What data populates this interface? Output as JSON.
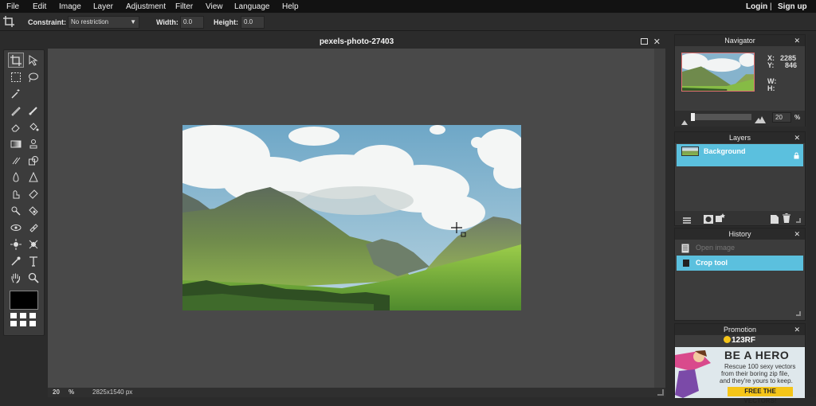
{
  "menubar": {
    "items": [
      "File",
      "Edit",
      "Image",
      "Layer",
      "Adjustment",
      "Filter",
      "View",
      "Language",
      "Help"
    ],
    "login": "Login",
    "separator": "|",
    "signup": "Sign up"
  },
  "options": {
    "constraint_label": "Constraint:",
    "constraint_value": "No restriction",
    "width_label": "Width:",
    "width_value": "0.0",
    "height_label": "Height:",
    "height_value": "0.0"
  },
  "document": {
    "title": "pexels-photo-27403",
    "zoom": "20",
    "zoom_unit": "%",
    "size": "2825x1540 px"
  },
  "navigator": {
    "title": "Navigator",
    "x_label": "X:",
    "x_value": "2285",
    "y_label": "Y:",
    "y_value": "846",
    "w_label": "W:",
    "h_label": "H:",
    "zoom": "20",
    "zoom_unit": "%"
  },
  "layers": {
    "title": "Layers",
    "items": [
      {
        "name": "Background"
      }
    ]
  },
  "history": {
    "title": "History",
    "items": [
      {
        "name": "Open image"
      },
      {
        "name": "Crop tool"
      }
    ]
  },
  "promotion": {
    "title": "Promotion",
    "brand": "123RF",
    "headline": "BE A HERO",
    "line1": "Rescue 100 sexy vectors",
    "line2": "from their boring zip file,",
    "line3": "and they're yours to keep.",
    "cta": "FREE THE VECTORS!"
  },
  "colors": {
    "accent": "#5bc0de",
    "menubar_bg": "#121212",
    "canvas_bg": "#494949",
    "panel_bg": "#3c3c3c",
    "promo_yellow": "#f5c518"
  }
}
